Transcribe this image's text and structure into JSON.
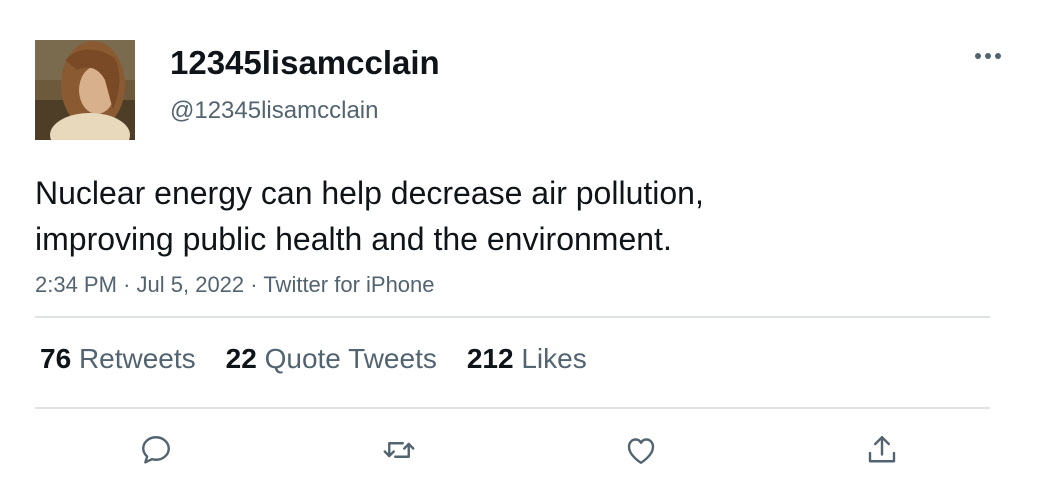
{
  "tweet": {
    "display_name": "12345lisamcclain",
    "handle": "@12345lisamcclain",
    "text_lines": [
      "Nuclear energy can help decrease air pollution,",
      "improving public health and the environment."
    ],
    "time": "2:34 PM",
    "date": "Jul 5, 2022",
    "source": "Twitter for iPhone",
    "separator": "·"
  },
  "stats": {
    "retweets": {
      "count": "76",
      "label": "Retweets"
    },
    "quote_tweets": {
      "count": "22",
      "label": "Quote Tweets"
    },
    "likes": {
      "count": "212",
      "label": "Likes"
    }
  },
  "icons": {
    "more": "more-horizontal-icon",
    "reply": "reply-icon",
    "retweet": "retweet-icon",
    "like": "heart-icon",
    "share": "share-icon"
  },
  "colors": {
    "text_primary": "#0f1419",
    "text_secondary": "#536471",
    "icon": "#536471",
    "divider": "#dfe3e6"
  }
}
